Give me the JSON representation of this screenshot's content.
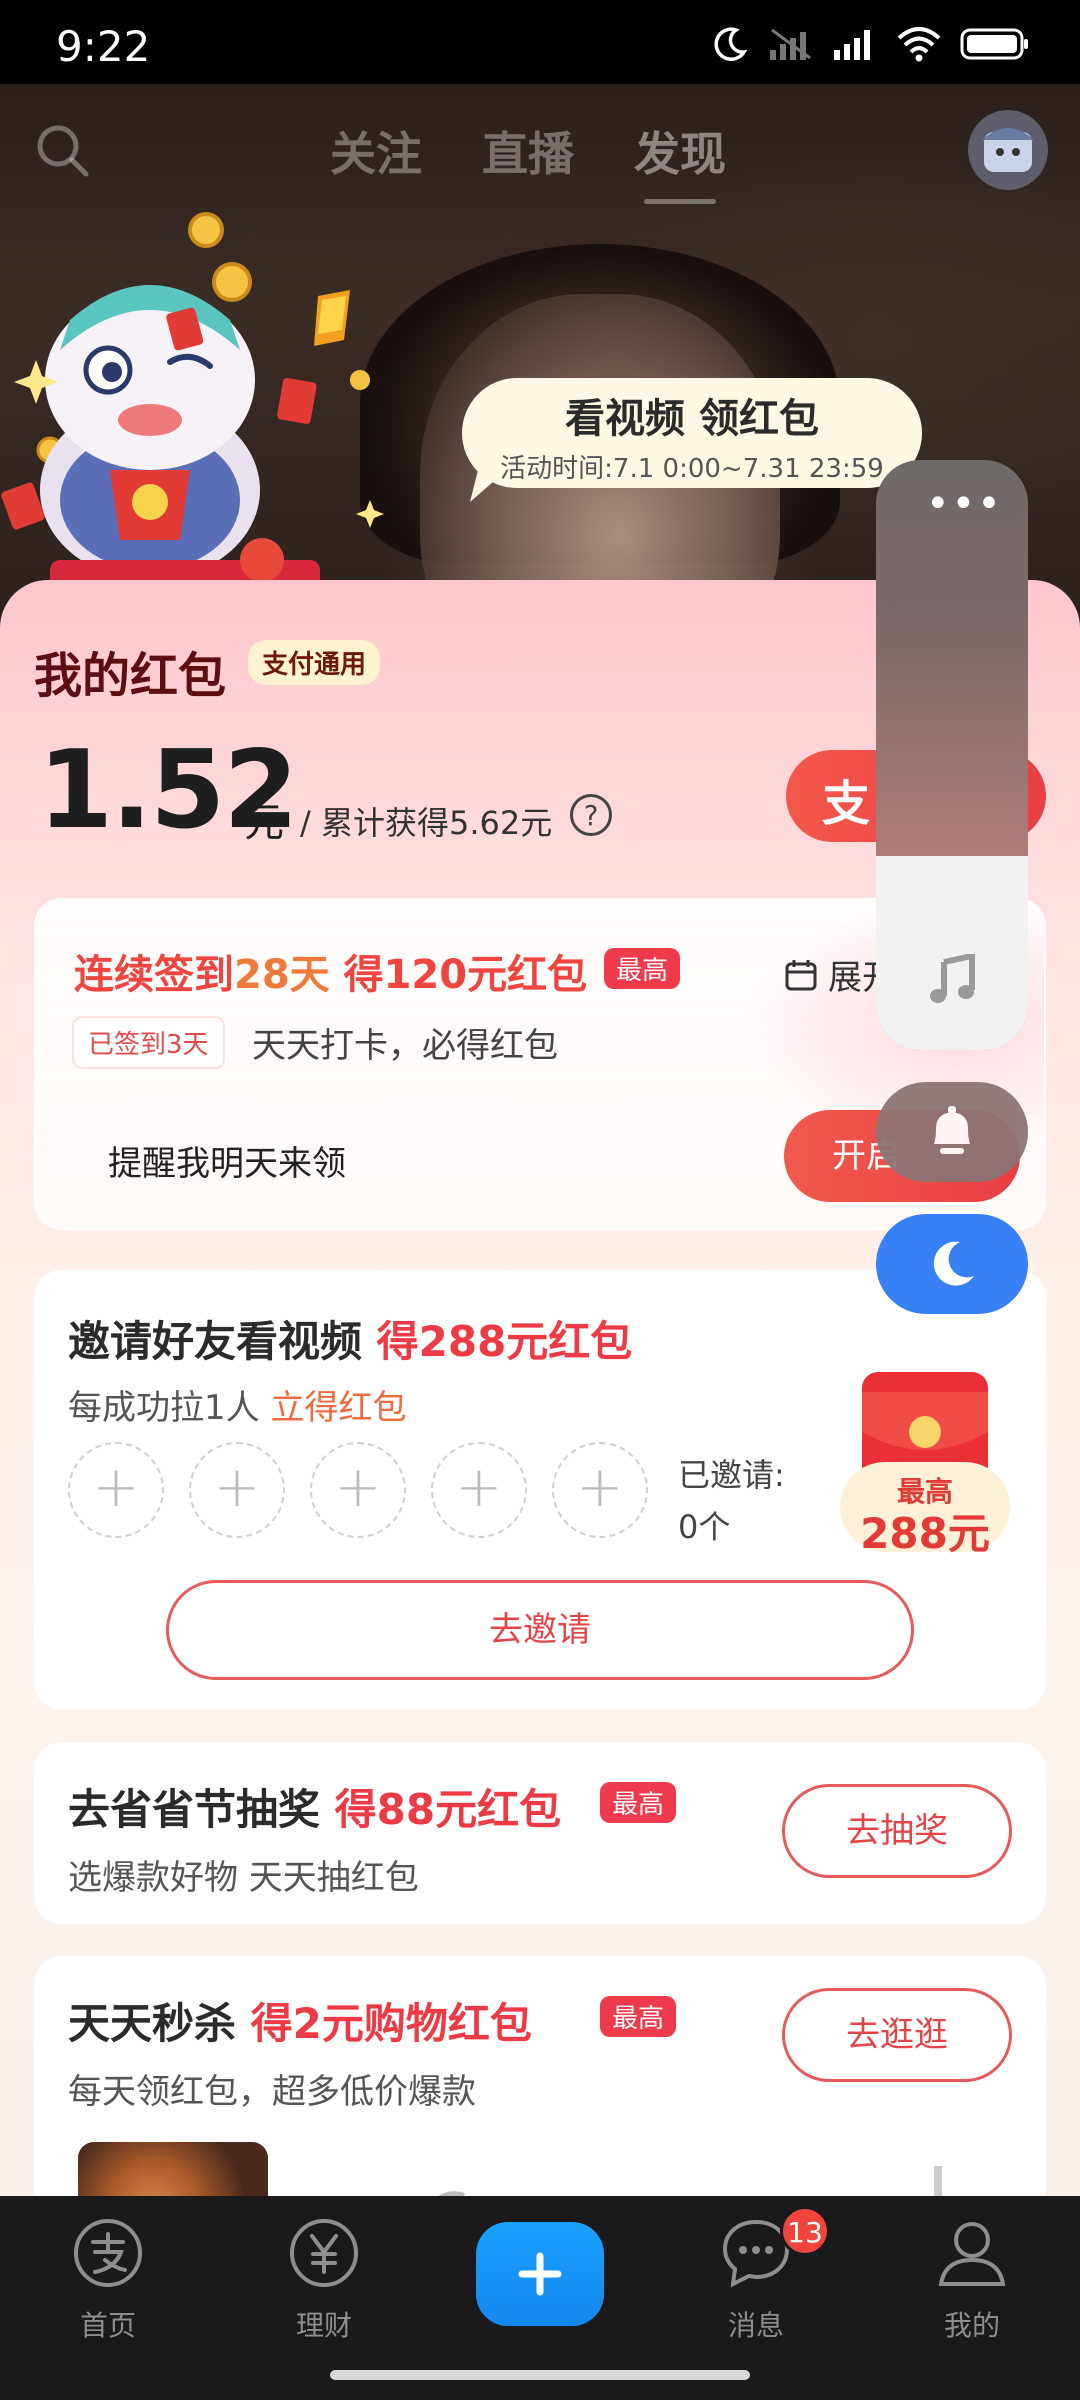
{
  "status_bar": {
    "time": "9:22"
  },
  "top_nav": {
    "tabs": [
      {
        "label": "关注",
        "active": false
      },
      {
        "label": "直播",
        "active": false
      },
      {
        "label": "发现",
        "active": true
      }
    ]
  },
  "promo_bubble": {
    "title": "看视频 领红包",
    "subtitle": "活动时间:7.1 0:00~7.31 23:59"
  },
  "wallet": {
    "title": "我的红包",
    "badge": "支付通用",
    "amount": "1.52",
    "unit": "元",
    "total_text": "/ 累计获得5.62元",
    "help_label": "?",
    "pay_button_glyph": "支"
  },
  "signin_card": {
    "title_main": "连续签到",
    "title_days": "28天",
    "title_reward": " 得120元红包",
    "hot_badge": "最高",
    "expand_label": "展开",
    "days_badge": "已签到3天",
    "description": "天天打卡，必得红包",
    "remind_text": "提醒我明天来领",
    "open_button": "开启"
  },
  "invite_card": {
    "title_main": "邀请好友看视频 ",
    "title_reward": "得288元红包",
    "subtitle_main": "每成功拉1人 ",
    "subtitle_highlight": "立得红包",
    "slot_symbol": "+",
    "invited_label": "已邀请:",
    "invited_count": "0个",
    "envelope_top": "最高",
    "envelope_amount": "288元",
    "button": "去邀请"
  },
  "lottery_card": {
    "title_main": "去省省节抽奖 ",
    "title_reward": "得88元红包",
    "hot_badge": "最高",
    "subtitle": "选爆款好物 天天抽红包",
    "button": "去抽奖"
  },
  "flash_card": {
    "title_main": "天天秒杀 ",
    "title_reward": "得2元购物红包",
    "hot_badge": "最高",
    "subtitle": "每天领红包，超多低价爆款",
    "button": "去逛逛"
  },
  "floating_panel": {
    "menu_glyph": "•••"
  },
  "tabbar": {
    "items": [
      {
        "label": "首页",
        "icon": "alipay-icon"
      },
      {
        "label": "理财",
        "icon": "yuan-icon"
      },
      {
        "label": "消息",
        "icon": "chat-icon"
      },
      {
        "label": "我的",
        "icon": "person-icon"
      }
    ],
    "message_badge": "13"
  },
  "colors": {
    "accent_red": "#ee3a44",
    "accent_blue": "#1487f0",
    "moon_blue": "#3780f5"
  }
}
